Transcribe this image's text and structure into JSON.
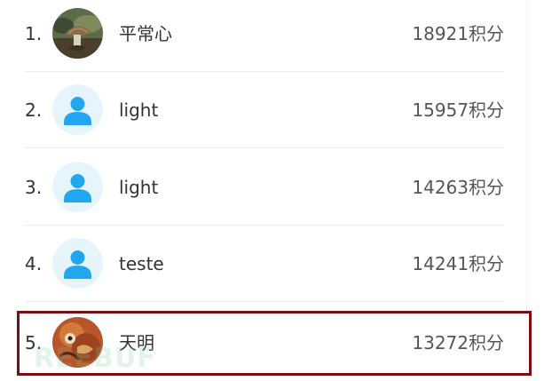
{
  "ranking": [
    {
      "rank": "1.",
      "name": "平常心",
      "score": "18921积分",
      "avatar": "mushroom-photo-avatar"
    },
    {
      "rank": "2.",
      "name": "light",
      "score": "15957积分",
      "avatar": "default-user-avatar"
    },
    {
      "rank": "3.",
      "name": "light",
      "score": "14263积分",
      "avatar": "default-user-avatar"
    },
    {
      "rank": "4.",
      "name": "teste",
      "score": "14241积分",
      "avatar": "default-user-avatar"
    },
    {
      "rank": "5.",
      "name": "天明",
      "score": "13272积分",
      "avatar": "cartoon-character-avatar"
    }
  ],
  "watermark": "REEBUF",
  "colors": {
    "highlight_border": "#7a0f12",
    "default_avatar_bg": "#e6f5fc",
    "default_avatar_fg": "#22a7ee"
  }
}
